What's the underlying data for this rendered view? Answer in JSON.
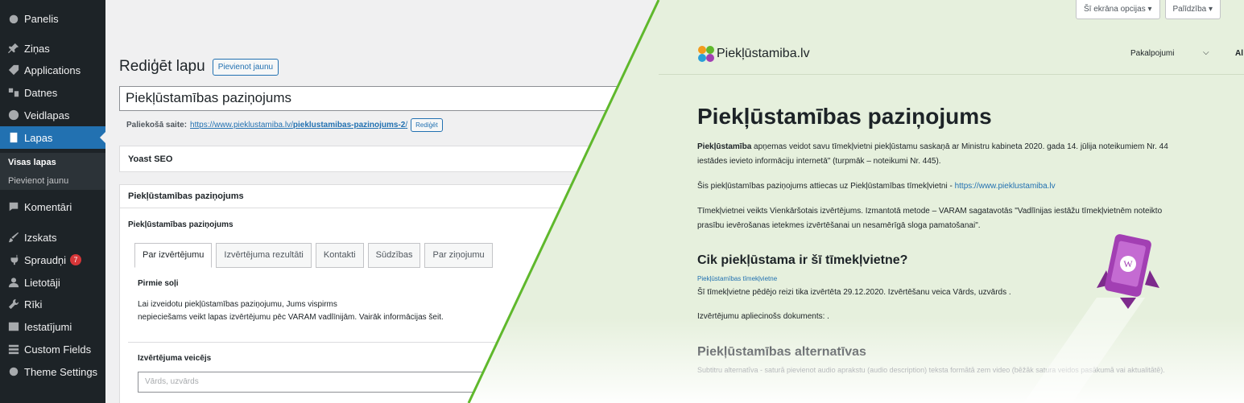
{
  "sidebar": {
    "items": [
      {
        "label": "Panelis",
        "icon": "dashboard-icon"
      },
      {
        "label": "Ziņas",
        "icon": "pin-icon"
      },
      {
        "label": "Applications",
        "icon": "tag-icon"
      },
      {
        "label": "Datnes",
        "icon": "media-icon"
      },
      {
        "label": "Veidlapas",
        "icon": "forms-icon"
      },
      {
        "label": "Lapas",
        "icon": "pages-icon"
      },
      {
        "label": "Komentāri",
        "icon": "comment-icon"
      },
      {
        "label": "Izskats",
        "icon": "brush-icon"
      },
      {
        "label": "Spraudņi",
        "icon": "plugin-icon",
        "badge": "7"
      },
      {
        "label": "Lietotāji",
        "icon": "user-icon"
      },
      {
        "label": "Rīki",
        "icon": "wrench-icon"
      },
      {
        "label": "Iestatījumi",
        "icon": "settings-icon"
      },
      {
        "label": "Custom Fields",
        "icon": "fields-icon"
      },
      {
        "label": "Theme Settings",
        "icon": "gear-icon"
      }
    ],
    "submenu": {
      "current": "Visas lapas",
      "other": "Pievienot jaunu"
    }
  },
  "editor": {
    "page_title": "Rediģēt lapu",
    "add_new": "Pievienot jaunu",
    "post_title": "Piekļūstamības paziņojums",
    "permalink_label": "Paliekošā saite:",
    "permalink_base": "https://www.pieklustamiba.lv/",
    "permalink_slug": "pieklustamibas-pazinojums-2",
    "permalink_end": "/",
    "permalink_edit": "Rediģēt",
    "yoast": "Yoast SEO",
    "box_title": "Piekļūstamības paziņojums",
    "box_subtitle": "Piekļūstamības paziņojums",
    "tabs": [
      "Par izvērtējumu",
      "Izvērtējuma rezultāti",
      "Kontakti",
      "Sūdzības",
      "Par ziņojumu"
    ],
    "tab_panel_title": "Pirmie soļi",
    "tab_panel_line1": "Lai izveidotu piekļūstamības paziņojumu, Jums vispirms",
    "tab_panel_line2": "nepieciešams veikt lapas izvērtējumu pēc VARAM vadlīnijām. Vairāk informācijas šeit.",
    "evaluator_label": "Izvērtējuma veicējs",
    "evaluator_placeholder": "Vārds, uzvārds"
  },
  "front": {
    "screen_options": "Šī ekrāna opcijas ▾",
    "help": "Palīdzība ▾",
    "logo_text": "Piekļūstamiba.lv",
    "nav_services": "Pakalpojumi",
    "nav_chevron": "⌵",
    "nav_more": "Al",
    "heading": "Piekļūstamības paziņojums",
    "p1_bold": "Piekļūstamība",
    "p1_rest": " apņemas veidot savu tīmekļvietni piekļūstamu saskaņā ar Ministru kabineta 2020. gada 14. jūlija noteikumiem Nr. 44",
    "p1_line2": "iestādes ievieto informāciju internetā\" (turpmāk – noteikumi Nr. 445).",
    "p2_text": "Šis piekļūstamības paziņojums attiecas uz Piekļūstamības tīmekļvietni - ",
    "p2_link": "https://www.pieklustamiba.lv",
    "p3_line1": "Tīmekļvietnei veikts Vienkāršotais izvērtējums. Izmantotā metode – VARAM sagatavotās \"Vadlīnijas iestāžu tīmekļvietnēm noteikto",
    "p3_line2": "prasību ievērošanas ietekmes izvērtēšanai un nesamērīgā sloga pamatošanai\".",
    "h2_1": "Cik piekļūstama ir šī tīmekļvietne?",
    "small_link": "Piekļūstamības tīmekļvietne",
    "p4": "Šī tīmekļvietne pēdējo reizi tika izvērtēta 29.12.2020. Izvērtēšanu veica Vārds, uzvārds .",
    "p5": "Izvērtējumu apliecinošs dokuments: .",
    "h2_2": "Piekļūstamības alternatīvas",
    "p6": "Subtitru alternatīva - saturā pievienot audio aprakstu (audio description) teksta formātā zem video (bēžāk  satura veidos pasākumā vai aktualitātē).",
    "accent_color": "#5fb82c",
    "rocket_color": "#a23fb3"
  }
}
